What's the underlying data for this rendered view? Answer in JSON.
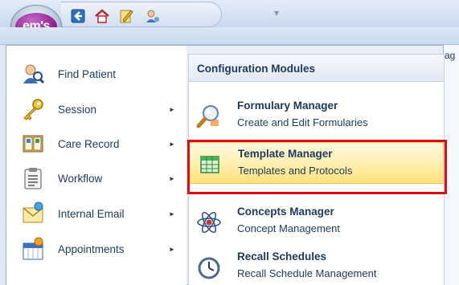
{
  "logo": {
    "text": "em's"
  },
  "quick_access": [
    {
      "icon": "back-icon"
    },
    {
      "icon": "home-icon"
    },
    {
      "icon": "edit-icon"
    },
    {
      "icon": "user-icon"
    }
  ],
  "background": {
    "right_fragment": "ag"
  },
  "left_menu": {
    "items": [
      {
        "label": "Find Patient",
        "icon": "find-patient-icon",
        "has_submenu": false
      },
      {
        "label": "Session",
        "icon": "key-icon",
        "has_submenu": true
      },
      {
        "label": "Care Record",
        "icon": "book-icon",
        "has_submenu": true
      },
      {
        "label": "Workflow",
        "icon": "clipboard-icon",
        "has_submenu": true
      },
      {
        "label": "Internal Email",
        "icon": "email-icon",
        "has_submenu": true
      },
      {
        "label": "Appointments",
        "icon": "calendar-icon",
        "has_submenu": true
      }
    ]
  },
  "submenu": {
    "header": "Configuration Modules",
    "items": [
      {
        "title": "Formulary Manager",
        "subtitle": "Create and Edit Formularies",
        "icon": "magnifier-icon",
        "highlighted": false
      },
      {
        "title": "Template Manager",
        "subtitle": "Templates and Protocols",
        "icon": "grid-icon",
        "highlighted": true
      },
      {
        "title": "Concepts Manager",
        "subtitle": "Concept Management",
        "icon": "atom-icon",
        "highlighted": false
      },
      {
        "title": "Recall Schedules",
        "subtitle": "Recall Schedule Management",
        "icon": "clock-icon",
        "highlighted": false
      }
    ]
  },
  "colors": {
    "highlight_top": "#fff9dd",
    "highlight_bottom": "#ffe17a",
    "annotation_red": "#e10d0d",
    "text": "#1e395b",
    "ribbon": "#cad9ee"
  }
}
